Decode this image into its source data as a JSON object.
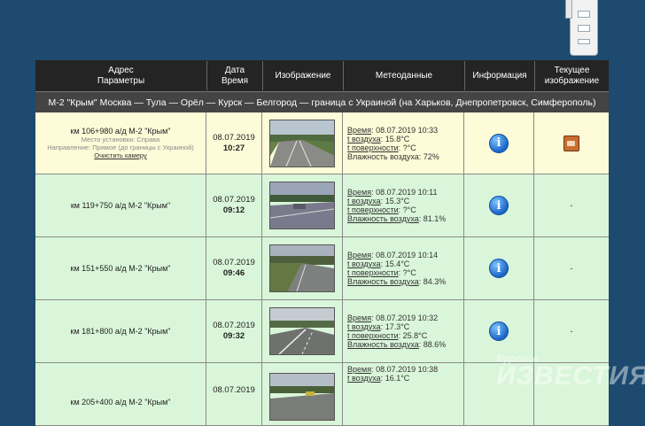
{
  "header": {
    "address": [
      "Адрес",
      "Параметры"
    ],
    "date": [
      "Дата",
      "Время"
    ],
    "image": "Изображение",
    "meteo": "Метеоданные",
    "info": "Информация",
    "current": [
      "Текущее",
      "изображение"
    ]
  },
  "route": "М-2 \"Крым\" Москва — Тула — Орёл — Курск — Белгород — граница с Украиной (на Харьков, Днепропетровск, Симферополь)",
  "meteo_labels": {
    "time": "Время",
    "air": "t воздуха",
    "surface": "t поверхности",
    "humidity": "Влажность воздуха"
  },
  "rows": [
    {
      "address": "км 106+980 а/д М-2 \"Крым\"",
      "location": "Место установки: Справа",
      "direction": "Направление: Прямое (до границы с Украиной)",
      "clear": "Очистить камеру",
      "date": "08.07.2019",
      "time": "10:27",
      "m_time": "08.07.2019 10:33",
      "m_air": "15.8°C",
      "m_surface": "?°C",
      "m_humidity": "72%",
      "current": "camera"
    },
    {
      "address": "км 119+750 а/д М-2 \"Крым\"",
      "date": "08.07.2019",
      "time": "09:12",
      "m_time": "08.07.2019 10:11",
      "m_air": "15.3°C",
      "m_surface": "?°C",
      "m_humidity": "81.1%",
      "current": "-"
    },
    {
      "address": "км 151+550 а/д М-2 \"Крым\"",
      "date": "08.07.2019",
      "time": "09:46",
      "m_time": "08.07.2019 10:14",
      "m_air": "15.4°C",
      "m_surface": "?°C",
      "m_humidity": "84.3%",
      "current": "-"
    },
    {
      "address": "км 181+800 а/д М-2 \"Крым\"",
      "date": "08.07.2019",
      "time": "09:32",
      "m_time": "08.07.2019 10:32",
      "m_air": "17.3°C",
      "m_surface": "25.8°C",
      "m_humidity": "88.6%",
      "current": "-"
    },
    {
      "address": "км 205+400 а/д М-2 \"Крым\"",
      "date": "08.07.2019",
      "m_time": "08.07.2019 10:38",
      "m_air": "16.1°C"
    }
  ],
  "info_glyph": "i",
  "watermark": {
    "top": "Курские",
    "main": "ИЗВЕСТИЯ"
  },
  "colors": {
    "background": "#1d4a6e",
    "header": "#242424",
    "row_first": "#fdfbd8",
    "row": "#daf6da"
  }
}
